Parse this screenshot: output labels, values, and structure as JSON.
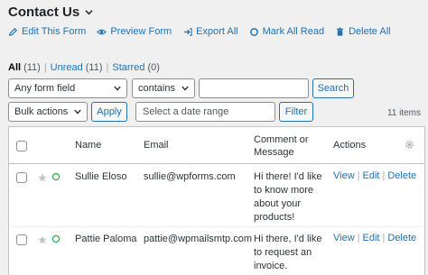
{
  "header": {
    "title": "Contact Us",
    "actions": [
      {
        "label": "Edit This Form",
        "icon": "pencil-icon"
      },
      {
        "label": "Preview Form",
        "icon": "eye-icon"
      },
      {
        "label": "Export All",
        "icon": "export-icon"
      },
      {
        "label": "Mark All Read",
        "icon": "circle-icon"
      },
      {
        "label": "Delete All",
        "icon": "trash-icon"
      }
    ]
  },
  "filters": {
    "all_label": "All",
    "all_count": "(11)",
    "unread_label": "Unread",
    "unread_count": "(11)",
    "starred_label": "Starred",
    "starred_count": "(0)",
    "separator": "|"
  },
  "search": {
    "field_select": "Any form field",
    "operator_select": "contains",
    "query_value": "",
    "button": "Search"
  },
  "bulk": {
    "select": "Bulk actions",
    "apply": "Apply",
    "date_placeholder": "Select a date range",
    "filter": "Filter",
    "items_count": "11 items"
  },
  "table": {
    "columns": {
      "name": "Name",
      "email": "Email",
      "comment": "Comment or Message",
      "actions": "Actions"
    },
    "rows": [
      {
        "name": "Sullie Eloso",
        "email": "sullie@wpforms.com",
        "comment_lines": [
          "Hi there! I'd like",
          "to know more",
          "about your",
          "products!"
        ],
        "view": "View",
        "edit": "Edit",
        "delete": "Delete"
      },
      {
        "name": "Pattie Paloma",
        "email": "pattie@wpmailsmtp.com",
        "comment_lines": [
          "Hi there, I'd like",
          "to request an",
          "invoice."
        ],
        "view": "View",
        "edit": "Edit",
        "delete": "Delete"
      }
    ]
  },
  "colors": {
    "link": "#2271b1",
    "unread_dot": "#00a32a",
    "background": "#f0f0f1"
  }
}
